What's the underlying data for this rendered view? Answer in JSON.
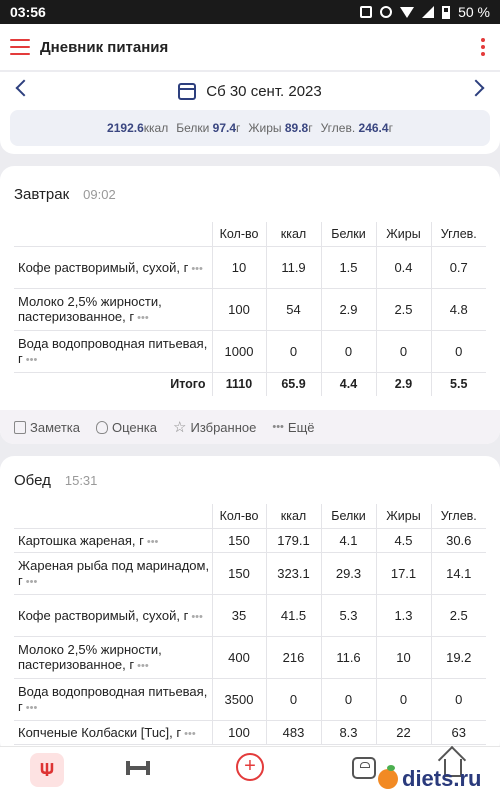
{
  "status": {
    "time": "03:56",
    "battery": "50 %"
  },
  "appbar": {
    "title": "Дневник питания"
  },
  "date": {
    "label": "Сб 30 сент. 2023"
  },
  "summary": {
    "kcal_value": "2192.6",
    "kcal_unit": "ккал",
    "protein_label": "Белки",
    "protein_value": "97.4",
    "protein_unit": "г",
    "fat_label": "Жиры",
    "fat_value": "89.8",
    "fat_unit": "г",
    "carbs_label": "Углев.",
    "carbs_value": "246.4",
    "carbs_unit": "г"
  },
  "columns": [
    "Кол-во",
    "ккал",
    "Белки",
    "Жиры",
    "Углев."
  ],
  "breakfast": {
    "name": "Завтрак",
    "time": "09:02",
    "rows": [
      {
        "food": "Кофе растворимый, сухой, г",
        "qty": "10",
        "kcal": "11.9",
        "p": "1.5",
        "f": "0.4",
        "c": "0.7"
      },
      {
        "food": "Молоко 2,5% жирности, пастеризованное, г",
        "qty": "100",
        "kcal": "54",
        "p": "2.9",
        "f": "2.5",
        "c": "4.8"
      },
      {
        "food": "Вода водопроводная питьевая, г",
        "qty": "1000",
        "kcal": "0",
        "p": "0",
        "f": "0",
        "c": "0"
      }
    ],
    "total": {
      "label": "Итого",
      "qty": "1110",
      "kcal": "65.9",
      "p": "4.4",
      "f": "2.9",
      "c": "5.5"
    },
    "actions": {
      "note": "Заметка",
      "rate": "Оценка",
      "fav": "Избранное",
      "more": "Ещё"
    }
  },
  "lunch": {
    "name": "Обед",
    "time": "15:31",
    "rows": [
      {
        "food": "Картошка жареная, г",
        "qty": "150",
        "kcal": "179.1",
        "p": "4.1",
        "f": "4.5",
        "c": "30.6"
      },
      {
        "food": "Жареная рыба под маринадом, г",
        "qty": "150",
        "kcal": "323.1",
        "p": "29.3",
        "f": "17.1",
        "c": "14.1"
      },
      {
        "food": "Кофе растворимый, сухой, г",
        "qty": "35",
        "kcal": "41.5",
        "p": "5.3",
        "f": "1.3",
        "c": "2.5"
      },
      {
        "food": "Молоко 2,5% жирности, пастеризованное, г",
        "qty": "400",
        "kcal": "216",
        "p": "11.6",
        "f": "10",
        "c": "19.2"
      },
      {
        "food": "Вода водопроводная питьевая, г",
        "qty": "3500",
        "kcal": "0",
        "p": "0",
        "f": "0",
        "c": "0"
      },
      {
        "food": "Копченые Колбаски [Tuc], г",
        "qty": "100",
        "kcal": "483",
        "p": "8.3",
        "f": "22",
        "c": "63"
      }
    ]
  },
  "watermark": "diets.ru",
  "dots": "•••"
}
